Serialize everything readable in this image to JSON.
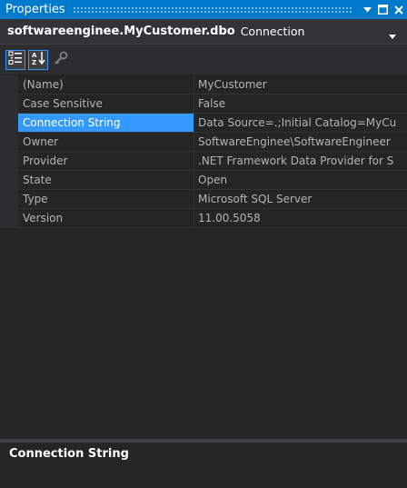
{
  "window": {
    "title": "Properties"
  },
  "object_selector": {
    "name": "softwareenginee.MyCustomer.dbo",
    "type": "Connection"
  },
  "toolbar": {
    "buttons": [
      {
        "icon": "categorized-icon",
        "checked": true
      },
      {
        "icon": "alphabetical-sort-icon",
        "checked": true
      },
      {
        "icon": "property-pages-icon",
        "checked": false
      }
    ]
  },
  "properties": [
    {
      "name": "(Name)",
      "value": "MyCustomer"
    },
    {
      "name": "Case Sensitive",
      "value": "False"
    },
    {
      "name": "Connection String",
      "value": "Data Source=.;Initial Catalog=MyCu"
    },
    {
      "name": "Owner",
      "value": "SoftwareEnginee\\SoftwareEngineer"
    },
    {
      "name": "Provider",
      "value": ".NET Framework Data Provider for S"
    },
    {
      "name": "State",
      "value": "Open"
    },
    {
      "name": "Type",
      "value": "Microsoft SQL Server"
    },
    {
      "name": "Version",
      "value": "11.00.5058"
    }
  ],
  "selected_property": "Connection String",
  "description": {
    "title": "Connection String"
  },
  "colors": {
    "accent": "#007acc",
    "selection": "#3399ff",
    "background": "#252526"
  }
}
